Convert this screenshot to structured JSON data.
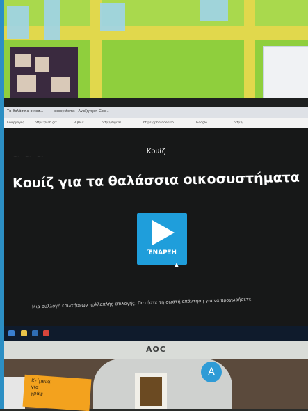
{
  "browser": {
    "tabs": [
      "Τα θαλάσσια οικοσ...",
      "ecosystems - Αναζήτηση Goo..."
    ],
    "bookmarks": [
      "Εφαρμογές",
      "https://sch.gr/",
      "Βιβλία",
      "http://digital...",
      "https://photodentro...",
      "Google",
      "http://"
    ]
  },
  "quiz": {
    "label": "Κουίζ",
    "title": "Κουίζ για τα θαλάσσια οικοσυστήματα",
    "start_label": "ΈΝΑΡΞΗ",
    "subtitle": "Μια συλλογή ερωτήσεων πολλαπλής επιλογής. Πατήστε τη σωστή απάντηση για να προχωρήσετε."
  },
  "monitor": {
    "brand": "AOC"
  },
  "desk": {
    "badge_letter": "A",
    "note_text": [
      "Κείμενα",
      "για",
      "γράψ"
    ]
  },
  "colors": {
    "button_blue": "#1f9edb",
    "screen_bg": "#171818",
    "wall_green": "#8fcf3d",
    "wall_yellow": "#e1d84c"
  }
}
